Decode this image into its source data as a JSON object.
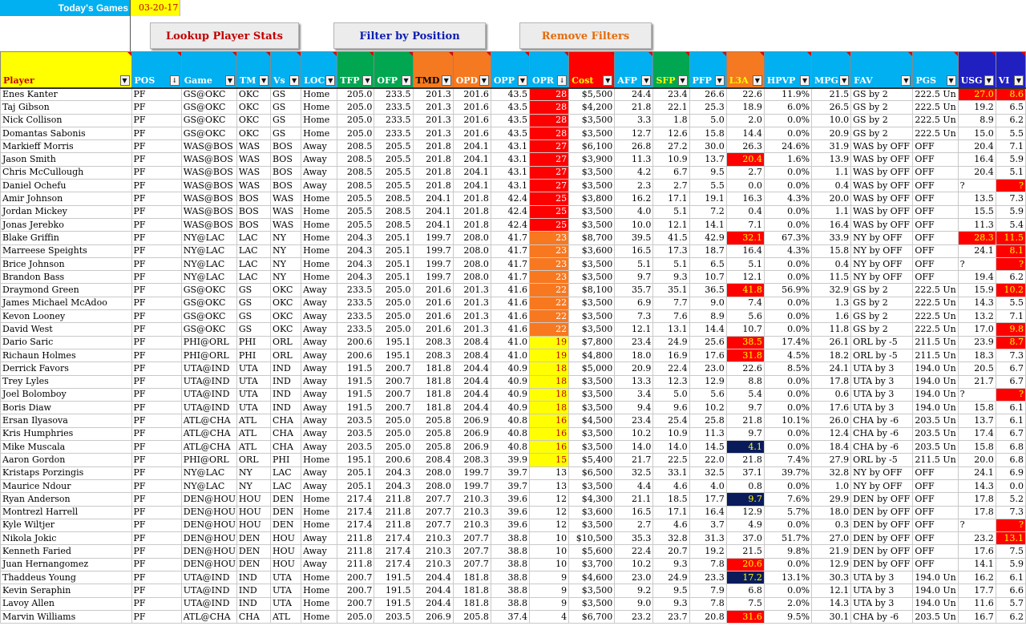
{
  "top": {
    "todays_games_label": "Today's Games",
    "date": "03-20-17"
  },
  "buttons": {
    "lookup": "Lookup Player Stats",
    "filter": "Filter by Position",
    "remove": "Remove Filters"
  },
  "columns": [
    {
      "key": "player",
      "label": "Player",
      "bg": "#FFFF00",
      "color": "#C00000"
    },
    {
      "key": "pos",
      "label": "POS",
      "bg": "#00B0F0",
      "color": "#ffffff",
      "sorted": true
    },
    {
      "key": "game",
      "label": "Game",
      "bg": "#00B0F0",
      "color": "#ffffff"
    },
    {
      "key": "tm",
      "label": "TM",
      "bg": "#00B0F0",
      "color": "#ffffff"
    },
    {
      "key": "vs",
      "label": "Vs",
      "bg": "#00B0F0",
      "color": "#ffffff"
    },
    {
      "key": "loc",
      "label": "LOC",
      "bg": "#00B0F0",
      "color": "#ffffff"
    },
    {
      "key": "tfp",
      "label": "TFP",
      "bg": "#00A650",
      "color": "#ffffff"
    },
    {
      "key": "ofp",
      "label": "OFP",
      "bg": "#00A650",
      "color": "#ffffff"
    },
    {
      "key": "tmd",
      "label": "TMD",
      "bg": "#F47920",
      "color": "#000000"
    },
    {
      "key": "opd",
      "label": "OPD",
      "bg": "#F47920",
      "color": "#ffffff"
    },
    {
      "key": "opp",
      "label": "OPP",
      "bg": "#00B0F0",
      "color": "#ffffff"
    },
    {
      "key": "opr",
      "label": "OPR",
      "bg": "#00B0F0",
      "color": "#ffffff",
      "sorted": true
    },
    {
      "key": "cost",
      "label": "Cost",
      "bg": "#FF0000",
      "color": "#FFFF00"
    },
    {
      "key": "afp",
      "label": "AFP",
      "bg": "#00B0F0",
      "color": "#ffffff"
    },
    {
      "key": "sfp",
      "label": "SFP",
      "bg": "#00A650",
      "color": "#FFFF00"
    },
    {
      "key": "pfp",
      "label": "PFP",
      "bg": "#00B0F0",
      "color": "#ffffff"
    },
    {
      "key": "l3a",
      "label": "L3A",
      "bg": "#F47920",
      "color": "#FFFF00"
    },
    {
      "key": "hpvp",
      "label": "HPVP",
      "bg": "#00B0F0",
      "color": "#ffffff"
    },
    {
      "key": "mpg",
      "label": "MPG",
      "bg": "#00B0F0",
      "color": "#ffffff"
    },
    {
      "key": "fav",
      "label": "FAV",
      "bg": "#00B0F0",
      "color": "#ffffff"
    },
    {
      "key": "pgs",
      "label": "PGS",
      "bg": "#00B0F0",
      "color": "#ffffff"
    },
    {
      "key": "usg",
      "label": "USG",
      "bg": "#2020C0",
      "color": "#ffffff"
    },
    {
      "key": "vi",
      "label": "VI",
      "bg": "#2020C0",
      "color": "#ffffff"
    }
  ],
  "rows": [
    [
      "Enes Kanter",
      "PF",
      "GS@OKC",
      "OKC",
      "GS",
      "Home",
      "205.0",
      "233.5",
      "201.3",
      "201.6",
      "43.5",
      "28",
      "$5,500",
      "24.4",
      "23.4",
      "26.6",
      "22.6",
      "11.9%",
      "21.5",
      "GS by 2",
      "222.5 Un",
      "27.0",
      "8.6"
    ],
    [
      "Taj Gibson",
      "PF",
      "GS@OKC",
      "OKC",
      "GS",
      "Home",
      "205.0",
      "233.5",
      "201.3",
      "201.6",
      "43.5",
      "28",
      "$4,200",
      "21.8",
      "22.1",
      "25.3",
      "18.9",
      "6.0%",
      "26.5",
      "GS by 2",
      "222.5 Un",
      "19.2",
      "6.5"
    ],
    [
      "Nick Collison",
      "PF",
      "GS@OKC",
      "OKC",
      "GS",
      "Home",
      "205.0",
      "233.5",
      "201.3",
      "201.6",
      "43.5",
      "28",
      "$3,500",
      "3.3",
      "1.8",
      "5.0",
      "2.0",
      "0.0%",
      "10.0",
      "GS by 2",
      "222.5 Un",
      "8.9",
      "6.2"
    ],
    [
      "Domantas Sabonis",
      "PF",
      "GS@OKC",
      "OKC",
      "GS",
      "Home",
      "205.0",
      "233.5",
      "201.3",
      "201.6",
      "43.5",
      "28",
      "$3,500",
      "12.7",
      "12.6",
      "15.8",
      "14.4",
      "0.0%",
      "20.9",
      "GS by 2",
      "222.5 Un",
      "15.0",
      "5.5"
    ],
    [
      "Markieff Morris",
      "PF",
      "WAS@BOS",
      "WAS",
      "BOS",
      "Away",
      "208.5",
      "205.5",
      "201.8",
      "204.1",
      "43.1",
      "27",
      "$6,100",
      "26.8",
      "27.2",
      "30.0",
      "26.3",
      "24.6%",
      "31.9",
      "WAS by OFF",
      "OFF",
      "20.4",
      "7.1"
    ],
    [
      "Jason Smith",
      "PF",
      "WAS@BOS",
      "WAS",
      "BOS",
      "Away",
      "208.5",
      "205.5",
      "201.8",
      "204.1",
      "43.1",
      "27",
      "$3,900",
      "11.3",
      "10.9",
      "13.7",
      "20.4",
      "1.6%",
      "13.9",
      "WAS by OFF",
      "OFF",
      "16.4",
      "5.9"
    ],
    [
      "Chris McCullough",
      "PF",
      "WAS@BOS",
      "WAS",
      "BOS",
      "Away",
      "208.5",
      "205.5",
      "201.8",
      "204.1",
      "43.1",
      "27",
      "$3,500",
      "4.2",
      "6.7",
      "9.5",
      "2.7",
      "0.0%",
      "1.1",
      "WAS by OFF",
      "OFF",
      "20.4",
      "5.1"
    ],
    [
      "Daniel Ochefu",
      "PF",
      "WAS@BOS",
      "WAS",
      "BOS",
      "Away",
      "208.5",
      "205.5",
      "201.8",
      "204.1",
      "43.1",
      "27",
      "$3,500",
      "2.3",
      "2.7",
      "5.5",
      "0.0",
      "0.0%",
      "0.4",
      "WAS by OFF",
      "OFF",
      "?",
      "?"
    ],
    [
      "Amir Johnson",
      "PF",
      "WAS@BOS",
      "BOS",
      "WAS",
      "Home",
      "205.5",
      "208.5",
      "204.1",
      "201.8",
      "42.4",
      "25",
      "$3,800",
      "16.2",
      "17.1",
      "19.1",
      "16.3",
      "4.3%",
      "20.0",
      "WAS by OFF",
      "OFF",
      "13.5",
      "7.3"
    ],
    [
      "Jordan Mickey",
      "PF",
      "WAS@BOS",
      "BOS",
      "WAS",
      "Home",
      "205.5",
      "208.5",
      "204.1",
      "201.8",
      "42.4",
      "25",
      "$3,500",
      "4.0",
      "5.1",
      "7.2",
      "0.4",
      "0.0%",
      "1.1",
      "WAS by OFF",
      "OFF",
      "15.5",
      "5.9"
    ],
    [
      "Jonas Jerebko",
      "PF",
      "WAS@BOS",
      "BOS",
      "WAS",
      "Home",
      "205.5",
      "208.5",
      "204.1",
      "201.8",
      "42.4",
      "25",
      "$3,500",
      "10.0",
      "12.1",
      "14.1",
      "7.1",
      "0.0%",
      "16.4",
      "WAS by OFF",
      "OFF",
      "11.3",
      "5.4"
    ],
    [
      "Blake Griffin",
      "PF",
      "NY@LAC",
      "LAC",
      "NY",
      "Home",
      "204.3",
      "205.1",
      "199.7",
      "208.0",
      "41.7",
      "23",
      "$8,700",
      "39.5",
      "41.5",
      "42.9",
      "32.1",
      "67.3%",
      "33.9",
      "NY by OFF",
      "OFF",
      "28.3",
      "11.5"
    ],
    [
      "Marreese Speights",
      "PF",
      "NY@LAC",
      "LAC",
      "NY",
      "Home",
      "204.3",
      "205.1",
      "199.7",
      "208.0",
      "41.7",
      "23",
      "$3,600",
      "16.5",
      "17.3",
      "18.7",
      "16.4",
      "4.3%",
      "15.8",
      "NY by OFF",
      "OFF",
      "24.1",
      "8.1"
    ],
    [
      "Brice Johnson",
      "PF",
      "NY@LAC",
      "LAC",
      "NY",
      "Home",
      "204.3",
      "205.1",
      "199.7",
      "208.0",
      "41.7",
      "23",
      "$3,500",
      "5.1",
      "5.1",
      "6.5",
      "5.1",
      "0.0%",
      "0.4",
      "NY by OFF",
      "OFF",
      "?",
      "?"
    ],
    [
      "Brandon Bass",
      "PF",
      "NY@LAC",
      "LAC",
      "NY",
      "Home",
      "204.3",
      "205.1",
      "199.7",
      "208.0",
      "41.7",
      "23",
      "$3,500",
      "9.7",
      "9.3",
      "10.7",
      "12.1",
      "0.0%",
      "11.5",
      "NY by OFF",
      "OFF",
      "19.4",
      "6.2"
    ],
    [
      "Draymond Green",
      "PF",
      "GS@OKC",
      "GS",
      "OKC",
      "Away",
      "233.5",
      "205.0",
      "201.6",
      "201.3",
      "41.6",
      "22",
      "$8,100",
      "35.7",
      "35.1",
      "36.5",
      "41.8",
      "56.9%",
      "32.9",
      "GS by 2",
      "222.5 Un",
      "15.9",
      "10.2"
    ],
    [
      "James Michael McAdoo",
      "PF",
      "GS@OKC",
      "GS",
      "OKC",
      "Away",
      "233.5",
      "205.0",
      "201.6",
      "201.3",
      "41.6",
      "22",
      "$3,500",
      "6.9",
      "7.7",
      "9.0",
      "7.4",
      "0.0%",
      "1.3",
      "GS by 2",
      "222.5 Un",
      "14.3",
      "5.5"
    ],
    [
      "Kevon Looney",
      "PF",
      "GS@OKC",
      "GS",
      "OKC",
      "Away",
      "233.5",
      "205.0",
      "201.6",
      "201.3",
      "41.6",
      "22",
      "$3,500",
      "7.3",
      "7.6",
      "8.9",
      "5.6",
      "0.0%",
      "1.6",
      "GS by 2",
      "222.5 Un",
      "13.2",
      "7.1"
    ],
    [
      "David West",
      "PF",
      "GS@OKC",
      "GS",
      "OKC",
      "Away",
      "233.5",
      "205.0",
      "201.6",
      "201.3",
      "41.6",
      "22",
      "$3,500",
      "12.1",
      "13.1",
      "14.4",
      "10.7",
      "0.0%",
      "11.8",
      "GS by 2",
      "222.5 Un",
      "17.0",
      "9.8"
    ],
    [
      "Dario Saric",
      "PF",
      "PHI@ORL",
      "PHI",
      "ORL",
      "Away",
      "200.6",
      "195.1",
      "208.3",
      "208.4",
      "41.0",
      "19",
      "$7,800",
      "23.4",
      "24.9",
      "25.6",
      "38.5",
      "17.4%",
      "26.1",
      "ORL by -5",
      "211.5 Un",
      "23.9",
      "8.7"
    ],
    [
      "Richaun Holmes",
      "PF",
      "PHI@ORL",
      "PHI",
      "ORL",
      "Away",
      "200.6",
      "195.1",
      "208.3",
      "208.4",
      "41.0",
      "19",
      "$4,800",
      "18.0",
      "16.9",
      "17.6",
      "31.8",
      "4.5%",
      "18.2",
      "ORL by -5",
      "211.5 Un",
      "18.3",
      "7.3"
    ],
    [
      "Derrick Favors",
      "PF",
      "UTA@IND",
      "UTA",
      "IND",
      "Away",
      "191.5",
      "200.7",
      "181.8",
      "204.4",
      "40.9",
      "18",
      "$5,000",
      "20.9",
      "22.4",
      "23.0",
      "22.6",
      "8.5%",
      "24.1",
      "UTA by 3",
      "194.0 Un",
      "20.5",
      "6.7"
    ],
    [
      "Trey Lyles",
      "PF",
      "UTA@IND",
      "UTA",
      "IND",
      "Away",
      "191.5",
      "200.7",
      "181.8",
      "204.4",
      "40.9",
      "18",
      "$3,500",
      "13.3",
      "12.3",
      "12.9",
      "8.8",
      "0.0%",
      "17.8",
      "UTA by 3",
      "194.0 Un",
      "21.7",
      "6.7"
    ],
    [
      "Joel Bolomboy",
      "PF",
      "UTA@IND",
      "UTA",
      "IND",
      "Away",
      "191.5",
      "200.7",
      "181.8",
      "204.4",
      "40.9",
      "18",
      "$3,500",
      "3.4",
      "5.0",
      "5.6",
      "5.4",
      "0.0%",
      "0.6",
      "UTA by 3",
      "194.0 Un",
      "?",
      "?"
    ],
    [
      "Boris Diaw",
      "PF",
      "UTA@IND",
      "UTA",
      "IND",
      "Away",
      "191.5",
      "200.7",
      "181.8",
      "204.4",
      "40.9",
      "18",
      "$3,500",
      "9.4",
      "9.6",
      "10.2",
      "9.7",
      "0.0%",
      "17.6",
      "UTA by 3",
      "194.0 Un",
      "15.8",
      "6.1"
    ],
    [
      "Ersan Ilyasova",
      "PF",
      "ATL@CHA",
      "ATL",
      "CHA",
      "Away",
      "203.5",
      "205.0",
      "205.8",
      "206.9",
      "40.8",
      "16",
      "$4,500",
      "23.4",
      "25.4",
      "25.8",
      "21.8",
      "10.1%",
      "26.0",
      "CHA by -6",
      "203.5 Un",
      "13.7",
      "6.1"
    ],
    [
      "Kris Humphries",
      "PF",
      "ATL@CHA",
      "ATL",
      "CHA",
      "Away",
      "203.5",
      "205.0",
      "205.8",
      "206.9",
      "40.8",
      "16",
      "$3,500",
      "10.2",
      "10.9",
      "11.3",
      "9.7",
      "0.0%",
      "12.4",
      "CHA by -6",
      "203.5 Un",
      "17.4",
      "6.7"
    ],
    [
      "Mike Muscala",
      "PF",
      "ATL@CHA",
      "ATL",
      "CHA",
      "Away",
      "203.5",
      "205.0",
      "205.8",
      "206.9",
      "40.8",
      "16",
      "$3,500",
      "14.0",
      "14.0",
      "14.5",
      "4.1",
      "0.0%",
      "18.4",
      "CHA by -6",
      "203.5 Un",
      "15.8",
      "6.8"
    ],
    [
      "Aaron Gordon",
      "PF",
      "PHI@ORL",
      "ORL",
      "PHI",
      "Home",
      "195.1",
      "200.6",
      "208.4",
      "208.3",
      "39.9",
      "15",
      "$5,400",
      "21.7",
      "22.5",
      "22.0",
      "21.8",
      "7.4%",
      "27.9",
      "ORL by -5",
      "211.5 Un",
      "20.0",
      "6.8"
    ],
    [
      "Kristaps Porzingis",
      "PF",
      "NY@LAC",
      "NY",
      "LAC",
      "Away",
      "205.1",
      "204.3",
      "208.0",
      "199.7",
      "39.7",
      "13",
      "$6,500",
      "32.5",
      "33.1",
      "32.5",
      "37.1",
      "39.7%",
      "32.8",
      "NY by OFF",
      "OFF",
      "24.1",
      "6.9"
    ],
    [
      "Maurice Ndour",
      "PF",
      "NY@LAC",
      "NY",
      "LAC",
      "Away",
      "205.1",
      "204.3",
      "208.0",
      "199.7",
      "39.7",
      "13",
      "$3,500",
      "4.4",
      "4.6",
      "4.0",
      "0.8",
      "0.0%",
      "1.0",
      "NY by OFF",
      "OFF",
      "14.3",
      "0.0"
    ],
    [
      "Ryan Anderson",
      "PF",
      "DEN@HOU",
      "HOU",
      "DEN",
      "Home",
      "217.4",
      "211.8",
      "207.7",
      "210.3",
      "39.6",
      "12",
      "$4,300",
      "21.1",
      "18.5",
      "17.7",
      "9.7",
      "7.6%",
      "29.9",
      "DEN by OFF",
      "OFF",
      "17.8",
      "5.2"
    ],
    [
      "Montrezl Harrell",
      "PF",
      "DEN@HOU",
      "HOU",
      "DEN",
      "Home",
      "217.4",
      "211.8",
      "207.7",
      "210.3",
      "39.6",
      "12",
      "$3,600",
      "16.5",
      "17.1",
      "16.4",
      "12.9",
      "5.7%",
      "18.0",
      "DEN by OFF",
      "OFF",
      "17.8",
      "7.3"
    ],
    [
      "Kyle Wiltjer",
      "PF",
      "DEN@HOU",
      "HOU",
      "DEN",
      "Home",
      "217.4",
      "211.8",
      "207.7",
      "210.3",
      "39.6",
      "12",
      "$3,500",
      "2.7",
      "4.6",
      "3.7",
      "4.9",
      "0.0%",
      "0.3",
      "DEN by OFF",
      "OFF",
      "?",
      "?"
    ],
    [
      "Nikola Jokic",
      "PF",
      "DEN@HOU",
      "DEN",
      "HOU",
      "Away",
      "211.8",
      "217.4",
      "210.3",
      "207.7",
      "38.8",
      "10",
      "$10,500",
      "35.3",
      "32.8",
      "31.3",
      "37.0",
      "51.7%",
      "27.0",
      "DEN by OFF",
      "OFF",
      "23.2",
      "13.1"
    ],
    [
      "Kenneth Faried",
      "PF",
      "DEN@HOU",
      "DEN",
      "HOU",
      "Away",
      "211.8",
      "217.4",
      "210.3",
      "207.7",
      "38.8",
      "10",
      "$5,600",
      "22.4",
      "20.7",
      "19.2",
      "21.5",
      "9.8%",
      "21.9",
      "DEN by OFF",
      "OFF",
      "17.6",
      "7.5"
    ],
    [
      "Juan Hernangomez",
      "PF",
      "DEN@HOU",
      "DEN",
      "HOU",
      "Away",
      "211.8",
      "217.4",
      "210.3",
      "207.7",
      "38.8",
      "10",
      "$3,700",
      "10.2",
      "9.3",
      "7.8",
      "20.6",
      "0.0%",
      "12.9",
      "DEN by OFF",
      "OFF",
      "14.1",
      "5.9"
    ],
    [
      "Thaddeus Young",
      "PF",
      "UTA@IND",
      "IND",
      "UTA",
      "Home",
      "200.7",
      "191.5",
      "204.4",
      "181.8",
      "38.8",
      "9",
      "$4,600",
      "23.0",
      "24.9",
      "23.3",
      "17.2",
      "13.1%",
      "30.3",
      "UTA by 3",
      "194.0 Un",
      "16.2",
      "6.1"
    ],
    [
      "Kevin Seraphin",
      "PF",
      "UTA@IND",
      "IND",
      "UTA",
      "Home",
      "200.7",
      "191.5",
      "204.4",
      "181.8",
      "38.8",
      "9",
      "$3,500",
      "9.2",
      "9.5",
      "7.9",
      "6.8",
      "0.0%",
      "12.1",
      "UTA by 3",
      "194.0 Un",
      "17.7",
      "6.6"
    ],
    [
      "Lavoy Allen",
      "PF",
      "UTA@IND",
      "IND",
      "UTA",
      "Home",
      "200.7",
      "191.5",
      "204.4",
      "181.8",
      "38.8",
      "9",
      "$3,500",
      "9.0",
      "9.3",
      "7.8",
      "7.5",
      "2.0%",
      "14.3",
      "UTA by 3",
      "194.0 Un",
      "11.6",
      "5.7"
    ],
    [
      "Marvin Williams",
      "PF",
      "ATL@CHA",
      "CHA",
      "ATL",
      "Home",
      "205.0",
      "203.5",
      "206.9",
      "205.8",
      "37.4",
      "4",
      "$6,700",
      "23.2",
      "23.7",
      "20.8",
      "31.6",
      "9.5%",
      "30.1",
      "CHA by -6",
      "203.5 Un",
      "16.7",
      "6.2"
    ]
  ],
  "highlights": {
    "l3a_red": [
      5,
      11,
      15,
      19,
      20,
      36,
      40
    ],
    "l3a_navy": [
      27,
      31,
      37
    ],
    "usg_red": [
      0,
      11
    ],
    "vi_red": [
      0,
      7,
      11,
      12,
      13,
      15,
      18,
      19,
      23,
      33,
      34
    ]
  },
  "colors": {
    "opr_red": "#FF0000",
    "opr_orange": "#F87820",
    "opr_yellow": "#FFFF00",
    "highlight_navy": "#0A1B5C",
    "header_blue": "#00B0F0"
  }
}
